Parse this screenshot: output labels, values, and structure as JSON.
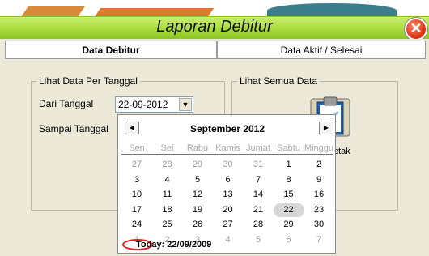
{
  "window": {
    "title": "Laporan Debitur"
  },
  "tabs": [
    {
      "label": "Data Debitur",
      "active": true
    },
    {
      "label": "Data Aktif / Selesai",
      "active": false
    }
  ],
  "left_group": {
    "legend": "Lihat Data Per Tanggal",
    "from_label": "Dari Tanggal",
    "from_value": "22-09-2012",
    "to_label": "Sampai Tanggal"
  },
  "right_group": {
    "legend": "Lihat Semua Data",
    "print_label": "etak"
  },
  "calendar": {
    "month_title": "September 2012",
    "prev_icon": "left-arrow-icon",
    "next_icon": "right-arrow-icon",
    "weekdays": [
      "Sen",
      "Sel",
      "Rabu",
      "Kamis",
      "Jumat",
      "Sabtu",
      "Minggu"
    ],
    "weeks": [
      [
        "27",
        "28",
        "29",
        "30",
        "31",
        "1",
        "2"
      ],
      [
        "3",
        "4",
        "5",
        "6",
        "7",
        "8",
        "9"
      ],
      [
        "10",
        "11",
        "12",
        "13",
        "14",
        "15",
        "16"
      ],
      [
        "17",
        "18",
        "19",
        "20",
        "21",
        "22",
        "23"
      ],
      [
        "24",
        "25",
        "26",
        "27",
        "28",
        "29",
        "30"
      ],
      [
        "1",
        "2",
        "3",
        "4",
        "5",
        "6",
        "7"
      ]
    ],
    "selected_day": "22",
    "today_text": "Today: 22/09/2009"
  },
  "colors": {
    "titlebar": "#a9dc3c",
    "close": "#e03a1a",
    "today_circle": "#e02020"
  }
}
